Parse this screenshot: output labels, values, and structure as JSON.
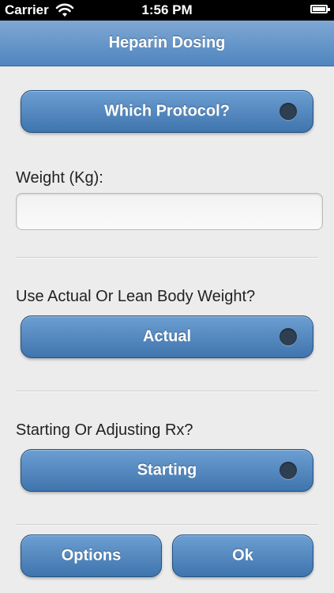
{
  "status_bar": {
    "carrier": "Carrier",
    "time": "1:56 PM"
  },
  "header": {
    "title": "Heparin Dosing"
  },
  "protocol": {
    "label": "Which Protocol?",
    "selected": false
  },
  "weight": {
    "label": "Weight (Kg):",
    "value": "",
    "placeholder": ""
  },
  "body_weight": {
    "question": "Use Actual Or Lean Body Weight?",
    "value": "Actual"
  },
  "rx": {
    "question": "Starting Or Adjusting Rx?",
    "value": "Starting"
  },
  "footer": {
    "options_label": "Options",
    "ok_label": "Ok"
  },
  "colors": {
    "accent": "#4f85bf",
    "button_top": "#6c9fd2",
    "button_bottom": "#3f74ad",
    "background": "#ececec"
  }
}
